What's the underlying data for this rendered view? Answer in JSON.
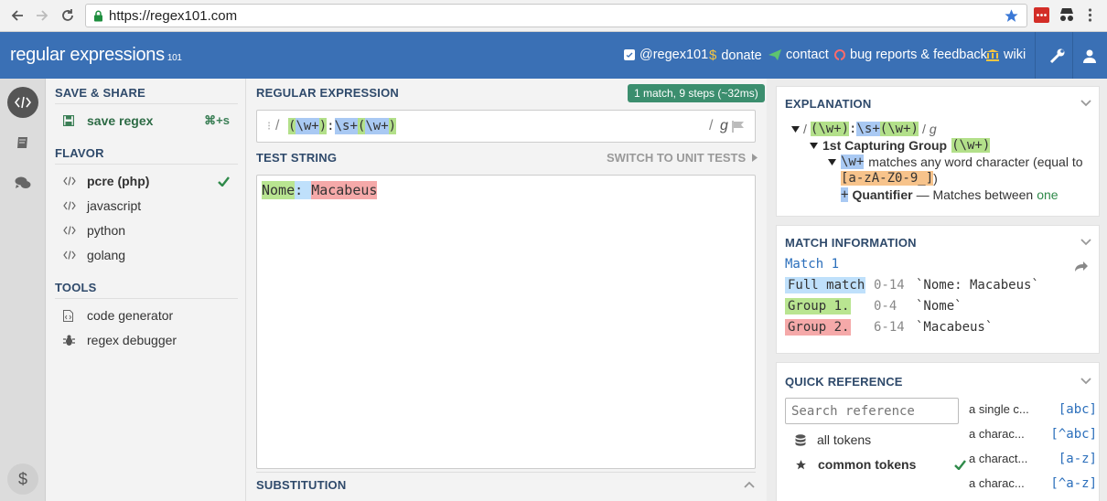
{
  "browser": {
    "url": "https://regex101.com"
  },
  "header": {
    "logo_main": "regular expressions",
    "logo_sub": "101",
    "links": [
      {
        "label": "@regex101",
        "icon": "twitter-icon"
      },
      {
        "label": "donate",
        "icon": "dollar-icon"
      },
      {
        "label": "contact",
        "icon": "paper-plane-icon"
      },
      {
        "label": "bug reports & feedback",
        "icon": "github-icon"
      },
      {
        "label": "wiki",
        "icon": "bank-icon"
      }
    ]
  },
  "sidebar": {
    "save_share_heading": "SAVE & SHARE",
    "save_regex_label": "save regex",
    "save_shortcut": "⌘+s",
    "flavor_heading": "FLAVOR",
    "flavors": [
      {
        "label": "pcre (php)",
        "selected": true
      },
      {
        "label": "javascript",
        "selected": false
      },
      {
        "label": "python",
        "selected": false
      },
      {
        "label": "golang",
        "selected": false
      }
    ],
    "tools_heading": "TOOLS",
    "tools": [
      {
        "label": "code generator",
        "icon": "code-file-icon"
      },
      {
        "label": "regex debugger",
        "icon": "bug-icon"
      }
    ]
  },
  "editor": {
    "regex_heading": "REGULAR EXPRESSION",
    "match_badge": "1 match, 9 steps (~32ms)",
    "delimiter_open": "/",
    "delimiter_close": "/",
    "flags": "g",
    "regex_tokens": [
      "(",
      "\\w+",
      ")",
      ":",
      "\\s+",
      "(",
      "\\w+",
      ")"
    ],
    "test_heading": "TEST STRING",
    "unit_tests_label": "SWITCH TO UNIT TESTS",
    "test_tokens": [
      "Nome",
      ":",
      " ",
      "Macabeus"
    ],
    "substitution_heading": "SUBSTITUTION"
  },
  "explanation": {
    "heading": "EXPLANATION",
    "line1_tokens": [
      "/",
      "(\\w+)",
      ":",
      "\\s+",
      "(\\w+)",
      "/",
      "g"
    ],
    "line2_text": "1st Capturing Group",
    "line2_token": "(\\w+)",
    "line3_token": "\\w+",
    "line3_text": "matches any word character (equal to",
    "line4_token": "[a-zA-Z0-9_]",
    "line4_text": ")",
    "line5_token": "+",
    "line5_bold": "Quantifier",
    "line5_text": "— Matches between",
    "line5_accent": "one"
  },
  "match_info": {
    "heading": "MATCH INFORMATION",
    "match_title": "Match 1",
    "rows": [
      {
        "label": "Full match",
        "range": "0-14",
        "value": "`Nome: Macabeus`",
        "color": "#bfe0fb"
      },
      {
        "label": "Group 1.",
        "range": "0-4",
        "value": "`Nome`",
        "color": "#b9e591"
      },
      {
        "label": "Group 2.",
        "range": "6-14",
        "value": "`Macabeus`",
        "color": "#f5a9a9"
      }
    ]
  },
  "quick_reference": {
    "heading": "QUICK REFERENCE",
    "search_placeholder": "Search reference",
    "categories": [
      {
        "label": "all tokens",
        "icon": "database-icon",
        "selected": false
      },
      {
        "label": "common tokens",
        "icon": "star-icon",
        "selected": true
      }
    ],
    "tokens": [
      {
        "desc": "a single c...",
        "token": "[abc]"
      },
      {
        "desc": "a charac...",
        "token": "[^abc]"
      },
      {
        "desc": "a charact...",
        "token": "[a-z]"
      },
      {
        "desc": "a charac...",
        "token": "[^a-z]"
      }
    ]
  },
  "colors": {
    "header_blue": "#3a70b5",
    "badge_green": "#3b8e6e",
    "group1_green": "#b3e08a",
    "group2_blue": "#a9c9f3",
    "match_green": "#b9e591",
    "match_red": "#f5a9a9",
    "accent_blue": "#2a6ebb"
  }
}
